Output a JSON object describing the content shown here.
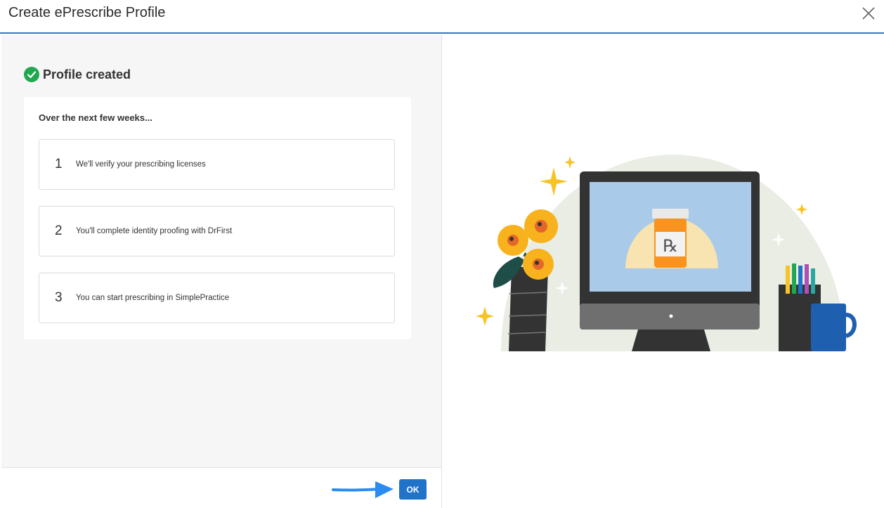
{
  "dialog": {
    "title": "Create ePrescribe Profile",
    "close_icon": "close-icon"
  },
  "status": {
    "icon": "check-circle-icon",
    "text": "Profile created",
    "color": "#1fa84f"
  },
  "steps_card": {
    "heading": "Over the next few weeks...",
    "steps": [
      {
        "number": "1",
        "text": "We'll verify your prescribing licenses"
      },
      {
        "number": "2",
        "text": "You'll complete identity proofing with DrFirst"
      },
      {
        "number": "3",
        "text": "You can start prescribing in SimplePractice"
      }
    ]
  },
  "illustration": {
    "rx_label": "℞"
  },
  "footer": {
    "ok_label": "OK",
    "arrow_icon": "arrow-right-icon",
    "accent_color": "#1f73c8"
  }
}
